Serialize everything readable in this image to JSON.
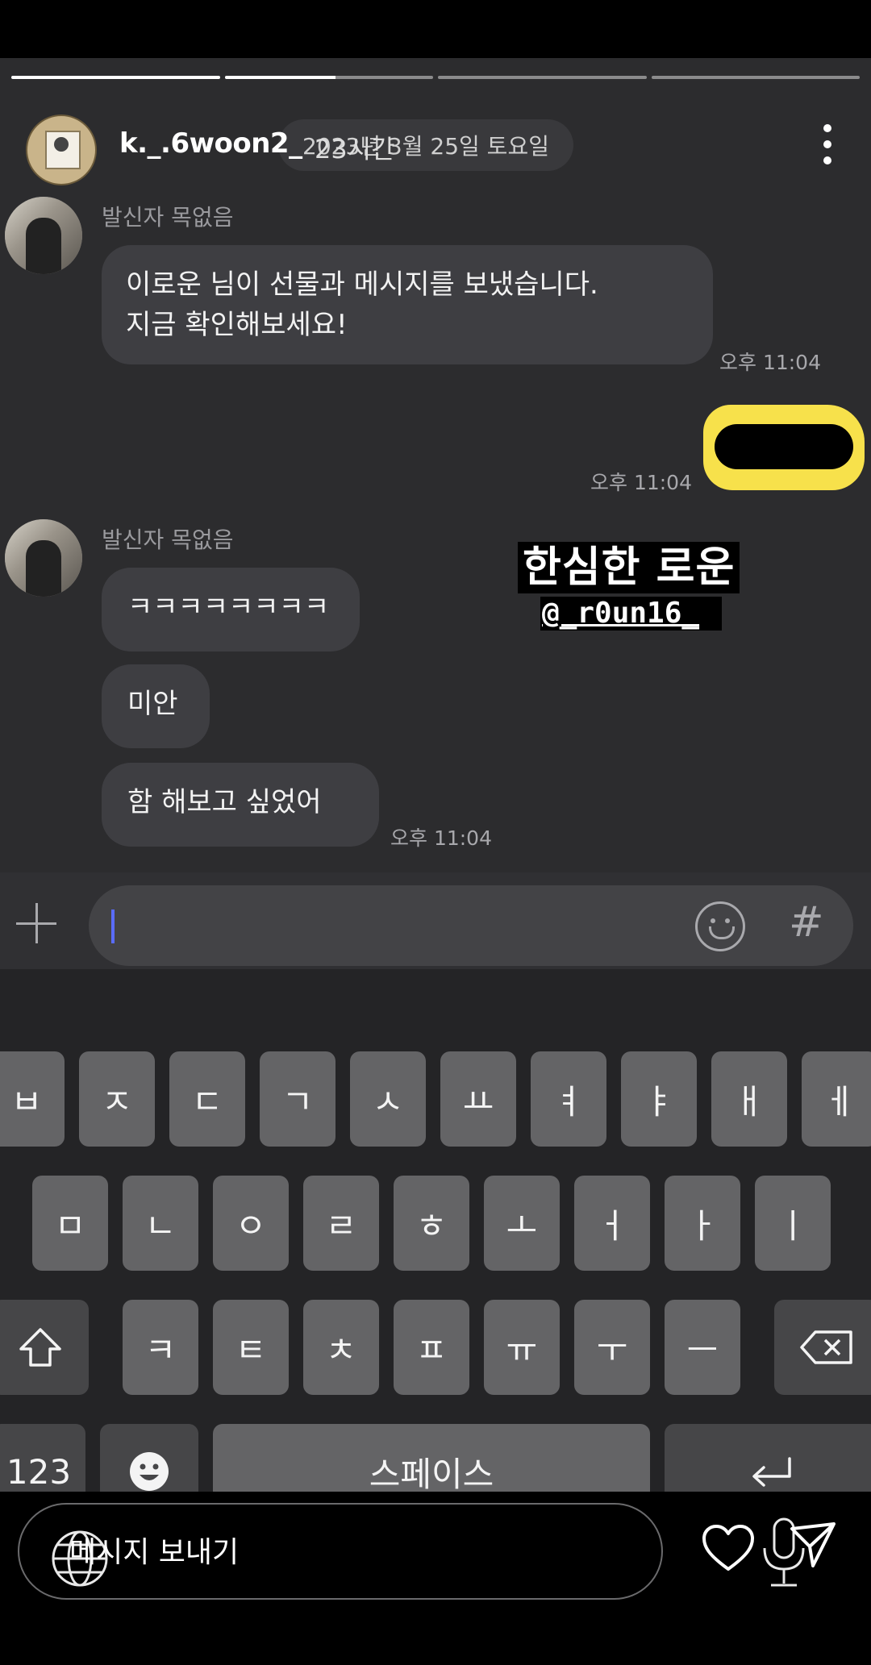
{
  "story": {
    "username": "k._.6woon2_",
    "time_ago": "23시간",
    "date_pill": "2023년 3월 25일 토요일",
    "progress": [
      1.0,
      0.53,
      0.0,
      0.0,
      0.0
    ]
  },
  "chat": {
    "msg1": {
      "sender": "발신자 목없음",
      "text_line1": "이로운 님이 선물과 메시지를 보냈습니다.",
      "text_line2": "지금 확인해보세요!",
      "time": "오후 11:04"
    },
    "sent": {
      "time": "오후 11:04"
    },
    "msg2": {
      "sender": "발신자 목없음",
      "bubbles": [
        "ㅋㅋㅋㅋㅋㅋㅋㅋ",
        "미안",
        "함 해보고 싶었어"
      ],
      "time": "오후 11:04"
    }
  },
  "overlay": {
    "title": "한심한 로운",
    "handle": "@_r0un16_"
  },
  "keyboard": {
    "row1": [
      "ㅂ",
      "ㅈ",
      "ㄷ",
      "ㄱ",
      "ㅅ",
      "ㅛ",
      "ㅕ",
      "ㅑ",
      "ㅐ",
      "ㅔ"
    ],
    "row2": [
      "ㅁ",
      "ㄴ",
      "ㅇ",
      "ㄹ",
      "ㅎ",
      "ㅗ",
      "ㅓ",
      "ㅏ",
      "ㅣ"
    ],
    "row3": [
      "ㅋ",
      "ㅌ",
      "ㅊ",
      "ㅍ",
      "ㅠ",
      "ㅜ",
      "ㅡ"
    ],
    "num_key": "123",
    "space_key": "스페이스",
    "icons": [
      "shift-icon",
      "backspace-icon",
      "emoji-icon",
      "enter-icon"
    ]
  },
  "bottom_bar": {
    "placeholder": "메시지 보내기",
    "icons": [
      "globe-icon",
      "heart-icon",
      "mic-icon",
      "send-icon"
    ]
  }
}
